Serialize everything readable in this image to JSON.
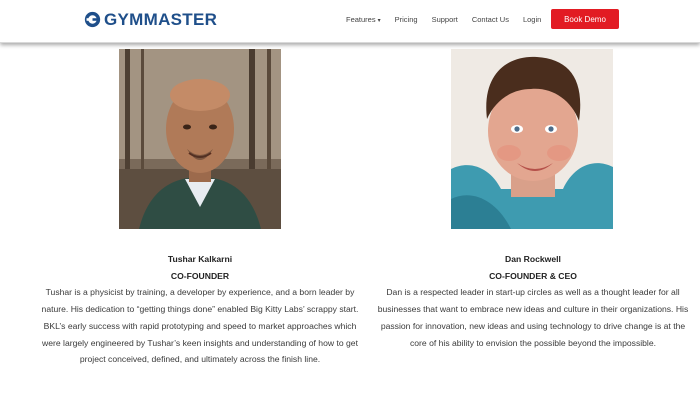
{
  "brand": {
    "name": "GYMMASTER"
  },
  "nav": {
    "items": [
      "Features",
      "Pricing",
      "Support",
      "Contact Us",
      "Login"
    ],
    "cta": "Book Demo"
  },
  "profiles": [
    {
      "name": "Tushar Kalkarni",
      "role": "CO-FOUNDER",
      "bio": "Tushar is a physicist by training, a developer by experience, and a born leader by nature. His dedication to “getting things done” enabled Big Kitty Labs’ scrappy start. BKL’s early success with rapid prototyping and speed to market approaches which were largely engineered by Tushar’s keen insights and understanding of how to get project conceived, defined, and ultimately across the finish line."
    },
    {
      "name": "Dan Rockwell",
      "role": "CO-FOUNDER & CEO",
      "bio": "Dan is a respected leader in start-up circles as well as a thought leader for all businesses that want to embrace new ideas and culture in their organizations. His passion for innovation, new ideas and using technology to drive change is at the core of his ability to envision the possible beyond the impossible."
    }
  ],
  "colors": {
    "brand_blue": "#1f4f8a",
    "cta_red": "#e21b23"
  }
}
